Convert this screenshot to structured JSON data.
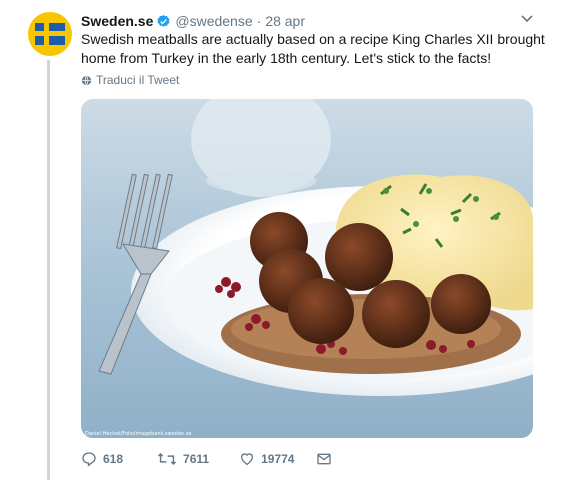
{
  "tweet": {
    "author_name": "Sweden.se",
    "handle": "@swedense",
    "separator": "·",
    "date": "28 apr",
    "text": "Swedish meatballs are actually based on a recipe King Charles XII brought home from Turkey in the early 18th century. Let's stick to the facts!",
    "translate_label": "Traduci il Tweet",
    "image_credit": "Daniel Hecisel/Folio/imagebank.sweden.se"
  },
  "actions": {
    "replies": "618",
    "retweets": "7611",
    "likes": "19774"
  },
  "icons": {
    "avatar": "swedish-flag-avatar",
    "verified": "verified-badge-icon",
    "menu": "chevron-down-icon",
    "translate": "globe-icon",
    "reply": "reply-icon",
    "retweet": "retweet-icon",
    "like": "heart-icon",
    "dm": "envelope-icon"
  },
  "colors": {
    "verified": "#1da1f2",
    "text_secondary": "#657786",
    "thread_line": "#ccd6dd",
    "flag_blue": "#1e5ba8",
    "flag_yellow": "#f7c600"
  }
}
